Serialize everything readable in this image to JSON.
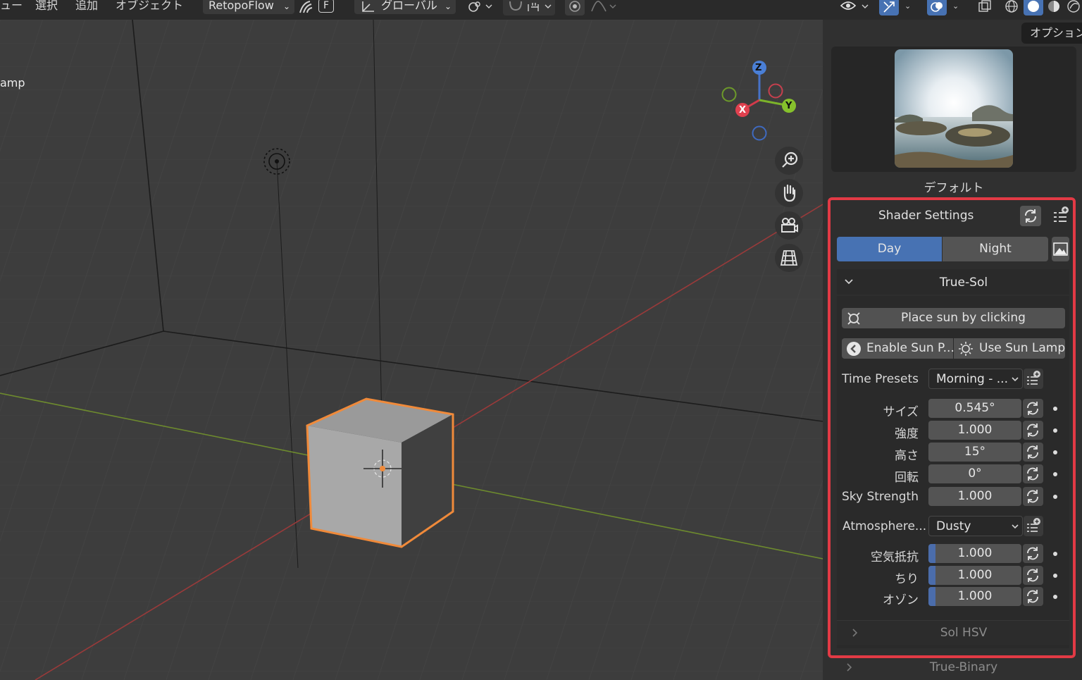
{
  "topbar": {
    "menu": [
      "ュー",
      "選択",
      "追加",
      "オブジェクト"
    ],
    "retopoflow": "RetopoFlow",
    "f_key": "F",
    "orientation": "グローバル"
  },
  "viewport": {
    "overlay_text": "amp",
    "gizmo": {
      "x": "X",
      "y": "Y",
      "z": "Z"
    }
  },
  "sidebar": {
    "options_tab": "オプション",
    "hdri_label": "デフォルト",
    "shader_settings": "Shader Settings",
    "tabs": {
      "day": "Day",
      "night": "Night",
      "active": "Day"
    },
    "true_sol": "True-Sol",
    "place_sun": "Place sun by clicking",
    "enable_sun": "Enable Sun P...",
    "use_sun_lamp": "Use Sun Lamp",
    "time_presets": {
      "label": "Time Presets",
      "value": "Morning - ..."
    },
    "sun_props": [
      {
        "label": "サイズ",
        "value": "0.545°"
      },
      {
        "label": "強度",
        "value": "1.000"
      },
      {
        "label": "高さ",
        "value": "15°"
      },
      {
        "label": "回転",
        "value": "0°"
      },
      {
        "label": "Sky Strength",
        "value": "1.000"
      }
    ],
    "atmosphere": {
      "label": "Atmosphere...",
      "value": "Dusty"
    },
    "atmo_props": [
      {
        "label": "空気抵抗",
        "value": "1.000"
      },
      {
        "label": "ちり",
        "value": "1.000"
      },
      {
        "label": "オゾン",
        "value": "1.000"
      }
    ],
    "sol_hsv": "Sol HSV",
    "true_binary": "True-Binary"
  },
  "colors": {
    "accent": "#4772b3",
    "highlight": "#e23a45",
    "selection": "#f08a3a"
  }
}
